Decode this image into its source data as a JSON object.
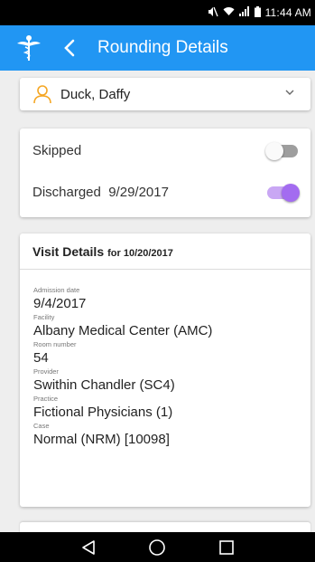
{
  "status_bar": {
    "time": "11:44 AM",
    "icons": [
      "mute-icon",
      "wifi-icon",
      "signal-icon",
      "battery-icon"
    ]
  },
  "app_bar": {
    "title": "Rounding Details",
    "background": "#2196f3",
    "logo_icon": "caduceus-icon",
    "back_icon": "chevron-left-icon"
  },
  "patient": {
    "name": "Duck, Daffy",
    "icon": "person-icon",
    "icon_color": "#f5a623",
    "dropdown_icon": "chevron-down-icon"
  },
  "status": {
    "skipped_label": "Skipped",
    "skipped_on": false,
    "discharged_label": "Discharged",
    "discharged_date": "9/29/2017",
    "discharged_on": true,
    "toggle_on_color": "#a36cf0"
  },
  "visit": {
    "title": "Visit Details",
    "for_text": "for 10/20/2017",
    "fields": [
      {
        "label": "Admission date",
        "value": "9/4/2017"
      },
      {
        "label": "Facility",
        "value": "Albany Medical Center (AMC)"
      },
      {
        "label": "Room number",
        "value": "54"
      },
      {
        "label": "Provider",
        "value": "Swithin Chandler (SC4)"
      },
      {
        "label": "Practice",
        "value": "Fictional Physicians (1)"
      },
      {
        "label": "Case",
        "value": "Normal (NRM) [10098]"
      }
    ]
  },
  "nav_bar": {
    "icons": [
      "back-triangle-icon",
      "home-circle-icon",
      "recents-square-icon"
    ]
  }
}
